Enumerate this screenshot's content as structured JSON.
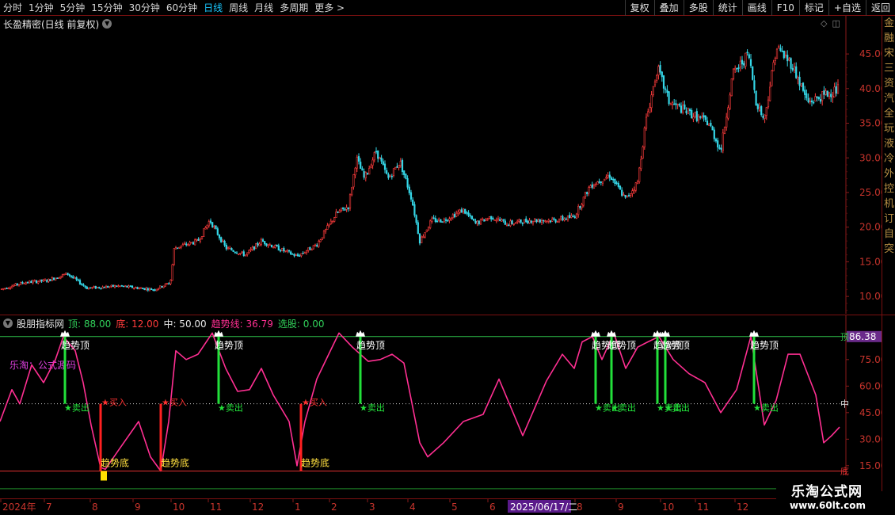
{
  "toolbar": {
    "period_tabs": [
      {
        "label": "分时",
        "active": false
      },
      {
        "label": "1分钟",
        "active": false
      },
      {
        "label": "5分钟",
        "active": false
      },
      {
        "label": "15分钟",
        "active": false
      },
      {
        "label": "30分钟",
        "active": false
      },
      {
        "label": "60分钟",
        "active": false
      },
      {
        "label": "日线",
        "active": true
      },
      {
        "label": "周线",
        "active": false
      },
      {
        "label": "月线",
        "active": false
      },
      {
        "label": "多周期",
        "active": false
      },
      {
        "label": "更多 >",
        "active": false
      }
    ],
    "buttons": [
      "复权",
      "叠加",
      "多股",
      "统计",
      "画线",
      "F10",
      "标记",
      "+自选",
      "返回"
    ]
  },
  "main_chart": {
    "title": "长盈精密(日线 前复权)",
    "y_ticks": [
      {
        "label": "45.00",
        "value": 45
      },
      {
        "label": "40.00",
        "value": 40
      },
      {
        "label": "35.00",
        "value": 35
      },
      {
        "label": "30.00",
        "value": 30
      },
      {
        "label": "25.00",
        "value": 25
      },
      {
        "label": "20.00",
        "value": 20
      },
      {
        "label": "15.00",
        "value": 15
      },
      {
        "label": "10.00",
        "value": 10
      }
    ],
    "y_range": [
      7.5,
      50.5
    ],
    "price_path": [
      [
        0,
        11
      ],
      [
        30,
        12
      ],
      [
        60,
        12.3
      ],
      [
        85,
        13.3
      ],
      [
        110,
        11.2
      ],
      [
        150,
        11.5
      ],
      [
        195,
        11
      ],
      [
        215,
        12
      ],
      [
        220,
        17
      ],
      [
        250,
        18
      ],
      [
        265,
        21
      ],
      [
        285,
        17
      ],
      [
        310,
        16
      ],
      [
        330,
        18
      ],
      [
        350,
        17
      ],
      [
        375,
        15.8
      ],
      [
        400,
        17.5
      ],
      [
        425,
        22
      ],
      [
        440,
        23
      ],
      [
        450,
        30
      ],
      [
        460,
        27
      ],
      [
        475,
        31
      ],
      [
        490,
        27
      ],
      [
        505,
        29.5
      ],
      [
        520,
        24
      ],
      [
        530,
        18
      ],
      [
        545,
        21
      ],
      [
        560,
        21
      ],
      [
        585,
        22.5
      ],
      [
        600,
        20.5
      ],
      [
        620,
        21.5
      ],
      [
        640,
        20.5
      ],
      [
        670,
        21
      ],
      [
        700,
        21
      ],
      [
        725,
        21.5
      ],
      [
        745,
        26
      ],
      [
        770,
        27.5
      ],
      [
        790,
        24
      ],
      [
        805,
        26.5
      ],
      [
        815,
        35
      ],
      [
        830,
        43
      ],
      [
        845,
        38
      ],
      [
        870,
        36.5
      ],
      [
        895,
        35
      ],
      [
        910,
        31
      ],
      [
        925,
        42
      ],
      [
        945,
        45
      ],
      [
        955,
        38
      ],
      [
        965,
        35.5
      ],
      [
        980,
        46
      ],
      [
        1000,
        43.5
      ],
      [
        1020,
        38
      ],
      [
        1040,
        39
      ],
      [
        1060,
        40
      ]
    ]
  },
  "indicator": {
    "name": "股朋指标网",
    "params": [
      {
        "label": "顶: 88.00",
        "color": "#31d15a"
      },
      {
        "label": "底: 12.00",
        "color": "#ff3b3b"
      },
      {
        "label": "中: 50.00",
        "color": "#e6e6e6"
      },
      {
        "label": "趋势线: 36.79",
        "color": "#ff2f92"
      },
      {
        "label": "选股: 0.00",
        "color": "#31d15a"
      }
    ],
    "y_ticks": [
      {
        "label": "75.00",
        "value": 75
      },
      {
        "label": "60.00",
        "value": 60
      },
      {
        "label": "45.00",
        "value": 45
      },
      {
        "label": "30.00",
        "value": 30
      },
      {
        "label": "15.00",
        "value": 15
      }
    ],
    "y_range": [
      -3,
      100
    ],
    "top_line": 88,
    "bottom_line": 12,
    "mid_line": 50,
    "current_value_label": "86.38",
    "top_marker": "顶",
    "mid_marker": "中",
    "bottom_marker": "底",
    "overlay_text": "乐淘：公式源码",
    "trend_path": [
      [
        0,
        40
      ],
      [
        15,
        58
      ],
      [
        25,
        50
      ],
      [
        40,
        72
      ],
      [
        55,
        62
      ],
      [
        70,
        75
      ],
      [
        80,
        88
      ],
      [
        95,
        80
      ],
      [
        105,
        62
      ],
      [
        115,
        38
      ],
      [
        127,
        14
      ],
      [
        133,
        13
      ],
      [
        150,
        24
      ],
      [
        175,
        40
      ],
      [
        190,
        20
      ],
      [
        203,
        12
      ],
      [
        213,
        40
      ],
      [
        222,
        80
      ],
      [
        235,
        75
      ],
      [
        250,
        78
      ],
      [
        268,
        90
      ],
      [
        285,
        70
      ],
      [
        300,
        57
      ],
      [
        315,
        58
      ],
      [
        330,
        70
      ],
      [
        345,
        55
      ],
      [
        365,
        40
      ],
      [
        375,
        15
      ],
      [
        385,
        40
      ],
      [
        400,
        64
      ],
      [
        415,
        78
      ],
      [
        428,
        90
      ],
      [
        445,
        82
      ],
      [
        465,
        74
      ],
      [
        480,
        75
      ],
      [
        495,
        78
      ],
      [
        510,
        73
      ],
      [
        530,
        28
      ],
      [
        540,
        20
      ],
      [
        560,
        28
      ],
      [
        585,
        40
      ],
      [
        610,
        44
      ],
      [
        630,
        64
      ],
      [
        660,
        32
      ],
      [
        690,
        63
      ],
      [
        710,
        78
      ],
      [
        725,
        70
      ],
      [
        735,
        85
      ],
      [
        748,
        88
      ],
      [
        760,
        75
      ],
      [
        775,
        90
      ],
      [
        790,
        70
      ],
      [
        805,
        82
      ],
      [
        818,
        85
      ],
      [
        832,
        88
      ],
      [
        850,
        75
      ],
      [
        870,
        67
      ],
      [
        890,
        62
      ],
      [
        910,
        45
      ],
      [
        930,
        58
      ],
      [
        948,
        88
      ],
      [
        965,
        38
      ],
      [
        980,
        52
      ],
      [
        995,
        78
      ],
      [
        1010,
        78
      ],
      [
        1030,
        55
      ],
      [
        1040,
        28
      ],
      [
        1050,
        32
      ],
      [
        1060,
        36.79
      ]
    ],
    "top_signals": [
      {
        "x": 80,
        "label": "趋势顶",
        "sell_label": "★卖出"
      },
      {
        "x": 274,
        "label": "趋势顶",
        "sell_label": "★卖出"
      },
      {
        "x": 453,
        "label": "趋势顶",
        "sell_label": "★卖出"
      },
      {
        "x": 750,
        "label": "趋势顶",
        "sell_label": "★卖出"
      },
      {
        "x": 770,
        "label": "趋势顶",
        "sell_label": "★卖出"
      },
      {
        "x": 828,
        "label": "趋势顶",
        "sell_label": "★卖出"
      },
      {
        "x": 838,
        "label": "趋势顶",
        "sell_label": "★卖出"
      },
      {
        "x": 950,
        "label": "趋势顶",
        "sell_label": "★卖出"
      }
    ],
    "bottom_signals": [
      {
        "x": 127,
        "label": "趋势底",
        "buy_label": "★买入"
      },
      {
        "x": 203,
        "label": "趋势底",
        "buy_label": "★买入"
      },
      {
        "x": 380,
        "label": "趋势底",
        "buy_label": "★买入"
      }
    ]
  },
  "date_axis": {
    "ticks": [
      {
        "label": "2024年",
        "x": 3
      },
      {
        "label": "7",
        "x": 58
      },
      {
        "label": "8",
        "x": 116
      },
      {
        "label": "9",
        "x": 170
      },
      {
        "label": "10",
        "x": 218
      },
      {
        "label": "11",
        "x": 265
      },
      {
        "label": "12",
        "x": 318
      },
      {
        "label": "1",
        "x": 372
      },
      {
        "label": "2",
        "x": 418
      },
      {
        "label": "3",
        "x": 466
      },
      {
        "label": "4",
        "x": 517
      },
      {
        "label": "5",
        "x": 570
      },
      {
        "label": "6",
        "x": 618
      }
    ],
    "cursor_date": "2025/06/17/二",
    "ticks_after": [
      {
        "label": "8",
        "x": 728
      },
      {
        "label": "9",
        "x": 780
      },
      {
        "label": "10",
        "x": 836
      },
      {
        "label": "11",
        "x": 880
      },
      {
        "label": "12",
        "x": 930
      }
    ]
  },
  "side_strip": [
    "金",
    "融",
    "宋",
    "三",
    "资",
    "汽",
    "全",
    "玩",
    "液",
    "冷",
    "外",
    "控",
    "机",
    "订",
    "自",
    "突"
  ],
  "watermark": {
    "title": "乐淘公式网",
    "url": "www.60lt.com"
  }
}
